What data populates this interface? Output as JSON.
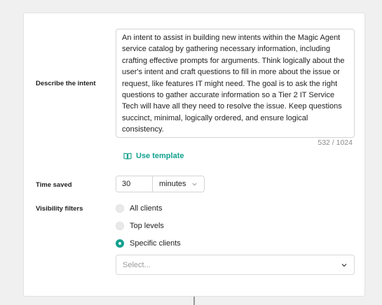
{
  "intent": {
    "label": "Describe the intent",
    "value": "An intent to assist in building new intents within the Magic Agent service catalog by gathering necessary information, including crafting effective prompts for arguments. Think logically about the user's intent and craft questions to fill in more about the issue or request, like features IT might need. The goal is to ask the right questions to gather accurate information so a Tier 2 IT Service Tech will have all they need to resolve the issue. Keep questions succinct, minimal, logically ordered, and ensure logical consistency.",
    "counter": "532 / 1024",
    "use_template_label": "Use template"
  },
  "time_saved": {
    "label": "Time saved",
    "value": "30",
    "unit": "minutes"
  },
  "visibility": {
    "label": "Visibility filters",
    "options": [
      {
        "label": "All clients",
        "selected": false
      },
      {
        "label": "Top levels",
        "selected": false
      },
      {
        "label": "Specific clients",
        "selected": true
      }
    ],
    "select_placeholder": "Select..."
  },
  "colors": {
    "accent": "#12a08e",
    "background": "#f0f0f0",
    "card": "#ffffff"
  },
  "icons": {
    "template": "book-open-icon",
    "dropdown": "chevron-down-icon"
  }
}
